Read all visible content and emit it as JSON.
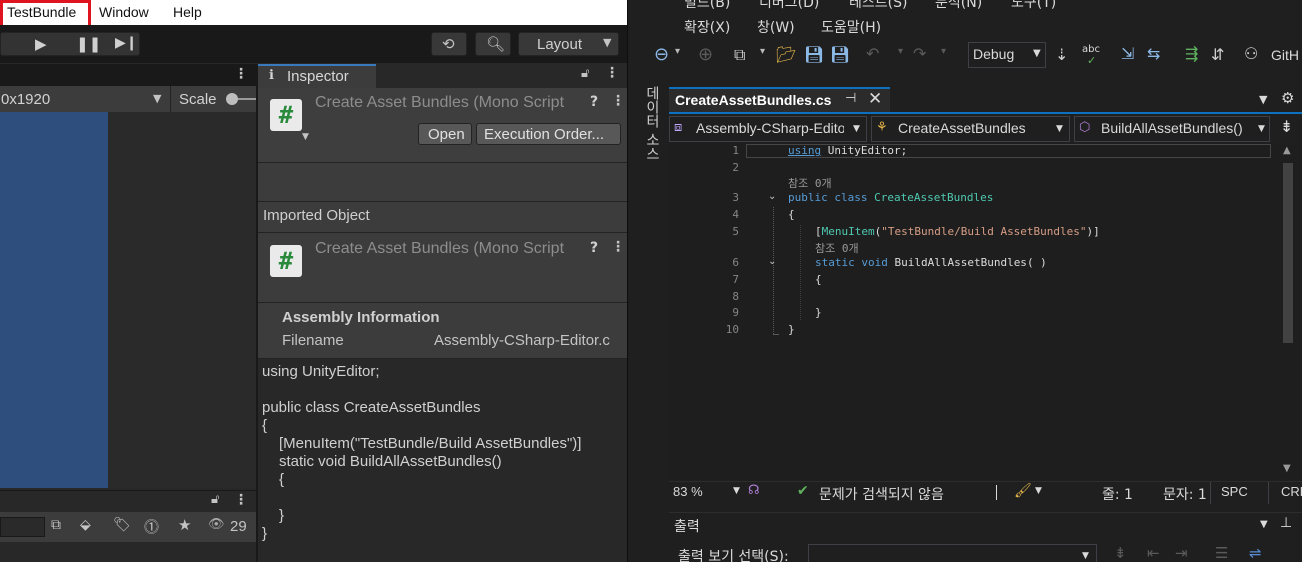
{
  "unity": {
    "menubar": {
      "items": [
        "TestBundle",
        "Window",
        "Help"
      ]
    },
    "toolbar": {
      "layout_label": "Layout"
    },
    "game": {
      "resolution": "0x1920",
      "scale_label": "Scale"
    },
    "project": {
      "hidden_count": "29"
    },
    "inspector": {
      "tab_label": "Inspector",
      "asset_title": "Create Asset Bundles (Mono Script",
      "open_button": "Open",
      "execution_order_button": "Execution Order...",
      "imported_object_label": "Imported Object",
      "imported_title": "Create Asset Bundles (Mono Script",
      "assembly_info_label": "Assembly Information",
      "filename_label": "Filename",
      "filename_value": "Assembly-CSharp-Editor.c",
      "script_lines": [
        "using UnityEditor;",
        "",
        "public class CreateAssetBundles",
        "{",
        "    [MenuItem(\"TestBundle/Build AssetBundles\")]",
        "    static void BuildAllAssetBundles()",
        "    {",
        "",
        "    }",
        "}"
      ]
    }
  },
  "vs": {
    "menu_row1": [
      "빌드(B)",
      "디버그(D)",
      "테스트(S)",
      "분석(N)",
      "도구(T)"
    ],
    "menu_row2": [
      "확장(X)",
      "창(W)",
      "도움말(H)"
    ],
    "config": "Debug",
    "github_label": "GitH",
    "side_label": "데이터 소스",
    "tab_title": "CreateAssetBundles.cs",
    "nav": {
      "project": "Assembly-CSharp-Edito",
      "class": "CreateAssetBundles",
      "member": "BuildAllAssetBundles()"
    },
    "code": {
      "line_numbers": [
        "1",
        "2",
        "3",
        "4",
        "5",
        "6",
        "7",
        "8",
        "9",
        "10"
      ],
      "ref_hint": "참조 0개",
      "line1_kw": "using",
      "line1_rest": " UnityEditor;",
      "line3_kw": "public class",
      "line3_type": " CreateAssetBundles",
      "brace_open": "{",
      "attr_open": "[",
      "attr_name": "MenuItem",
      "attr_paren_open": "(",
      "attr_string": "\"TestBundle/Build AssetBundles\"",
      "attr_close": ")]",
      "method_kw": "static void",
      "method_name": " BuildAllAssetBundles",
      "method_parens": "( )",
      "brace_close": "}"
    },
    "status": {
      "zoom": "83 %",
      "issues": "문제가 검색되지 않음",
      "line": "줄: 1",
      "col": "문자: 1",
      "spc": "SPC",
      "crlf": "CRL"
    },
    "output": {
      "title": "출력",
      "show_from_label": "출력 보기 선택(S):"
    }
  }
}
